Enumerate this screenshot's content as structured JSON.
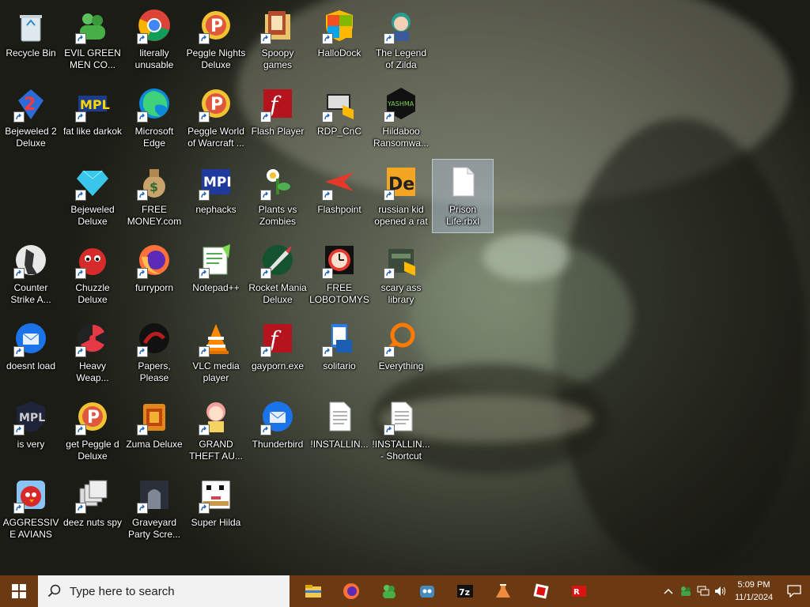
{
  "desktop": {
    "icons": [
      {
        "label": "Recycle Bin",
        "icon": "recycle-bin-icon"
      },
      {
        "label": "EVIL GREEN MEN CO...",
        "icon": "green-men-icon"
      },
      {
        "label": "literally unusable",
        "icon": "chrome-icon"
      },
      {
        "label": "Peggle Nights Deluxe",
        "icon": "peggle-icon"
      },
      {
        "label": "Spoopy games",
        "icon": "folder-icon"
      },
      {
        "label": "HalloDock",
        "icon": "windows-shield-icon"
      },
      {
        "label": "The Legend of Zilda",
        "icon": "character-icon"
      },
      {
        "label": "Bejeweled 2 Deluxe",
        "icon": "bejeweled2-icon"
      },
      {
        "label": "fat like darkok",
        "icon": "mpl-icon"
      },
      {
        "label": "Microsoft Edge",
        "icon": "edge-icon"
      },
      {
        "label": "Peggle World of Warcraft ...",
        "icon": "peggle-icon"
      },
      {
        "label": "Flash Player",
        "icon": "flash-icon"
      },
      {
        "label": "RDP_CnC",
        "icon": "rdp-icon"
      },
      {
        "label": "Hildaboo Ransomwa...",
        "icon": "yashma-icon"
      },
      {
        "label": "Prison Life.rbxl",
        "icon": "file-icon"
      },
      {
        "label": "Bejeweled Deluxe",
        "icon": "gem-icon"
      },
      {
        "label": "FREE MONEY.com",
        "icon": "money-bag-icon"
      },
      {
        "label": "nephacks",
        "icon": "mpi-icon"
      },
      {
        "label": "Plants vs Zombies",
        "icon": "plant-icon"
      },
      {
        "label": "Flashpoint",
        "icon": "flashpoint-icon"
      },
      {
        "label": "russian kid opened a rat",
        "icon": "de-icon"
      },
      {
        "label": "Counter Strike A...",
        "icon": "counter-strike-icon"
      },
      {
        "label": "Chuzzle Deluxe",
        "icon": "chuzzle-icon"
      },
      {
        "label": "furryporn",
        "icon": "firefox-icon"
      },
      {
        "label": "Notepad++",
        "icon": "notepad-plus-icon"
      },
      {
        "label": "Rocket Mania Deluxe",
        "icon": "rocket-icon"
      },
      {
        "label": "FREE LOBOTOMYS",
        "icon": "clock-icon"
      },
      {
        "label": "scary ass library",
        "icon": "library-icon"
      },
      {
        "label": "doesnt load",
        "icon": "thunderbird-icon"
      },
      {
        "label": "Heavy Weap...",
        "icon": "radiation-icon"
      },
      {
        "label": "Papers, Please",
        "icon": "papers-please-icon"
      },
      {
        "label": "VLC media player",
        "icon": "vlc-icon"
      },
      {
        "label": "gayporn.exe",
        "icon": "flash-icon"
      },
      {
        "label": "solitario",
        "icon": "solitaire-icon"
      },
      {
        "label": "Everything",
        "icon": "everything-search-icon"
      },
      {
        "label": "is very",
        "icon": "mpl-shield-icon"
      },
      {
        "label": "get Peggle d Deluxe",
        "icon": "peggle-icon"
      },
      {
        "label": "Zuma Deluxe",
        "icon": "zuma-icon"
      },
      {
        "label": "GRAND THEFT AU...",
        "icon": "anime-girl-icon"
      },
      {
        "label": "Thunderbird",
        "icon": "thunderbird-icon"
      },
      {
        "label": "!INSTALLIN...",
        "icon": "text-file-icon"
      },
      {
        "label": "!INSTALLIN... - Shortcut",
        "icon": "text-file-icon"
      },
      {
        "label": "AGGRESSIVE AVIANS",
        "icon": "angry-bird-icon"
      },
      {
        "label": "deez nuts spy",
        "icon": "windows-stack-icon"
      },
      {
        "label": "Graveyard Party Scre...",
        "icon": "graveyard-icon"
      },
      {
        "label": "Super Hilda",
        "icon": "pixel-icon"
      }
    ]
  },
  "taskbar": {
    "search_placeholder": "Type here to search",
    "pinned": [
      "file-explorer-icon",
      "firefox-icon",
      "green-men-icon",
      "godot-icon",
      "7zip-icon",
      "flask-icon",
      "roblox-studio-icon",
      "roblox-icon"
    ],
    "clock": {
      "time": "5:09 PM",
      "date": "11/1/2024"
    }
  },
  "colors": {
    "taskbar": "#6b3a12",
    "search_bg": "#f2f2f2"
  }
}
